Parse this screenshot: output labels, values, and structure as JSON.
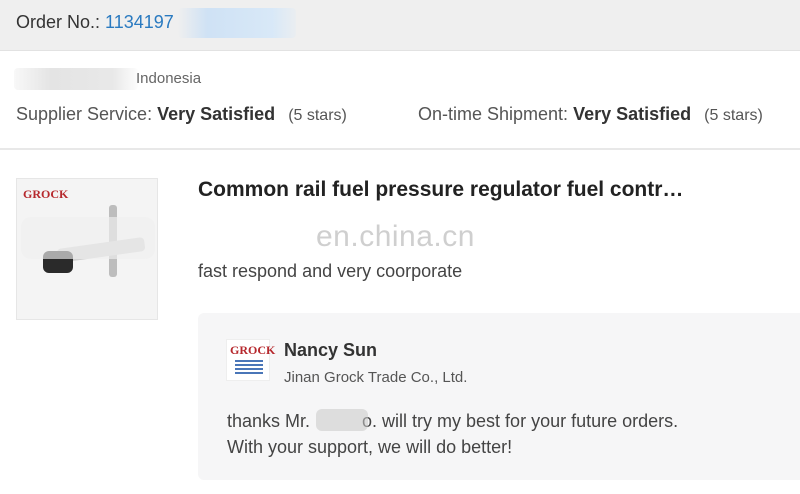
{
  "order": {
    "label": "Order No.:",
    "number_visible": "1134197"
  },
  "buyer": {
    "country": "Indonesia"
  },
  "ratings": [
    {
      "label": "Supplier Service:",
      "value": "Very Satisfied",
      "stars": "(5 stars)"
    },
    {
      "label": "On-time Shipment:",
      "value": "Very Satisfied",
      "stars": "(5 stars)"
    }
  ],
  "product": {
    "logo_text": "GROCK",
    "title": "Common rail fuel pressure regulator fuel contr…"
  },
  "watermark": "en.china.cn",
  "review": {
    "text": "fast respond and very coorporate"
  },
  "reply": {
    "logo_text": "GROCK",
    "name": "Nancy Sun",
    "company": "Jinan Grock Trade Co., Ltd.",
    "line1_prefix": "thanks Mr.",
    "line1_suffix": "o. will try my best for your future orders.",
    "line2": "With your support, we will do better!"
  },
  "colors": {
    "header_bg": "#efefef",
    "link": "#2a7ac0",
    "reply_bg": "#f6f6f7",
    "logo_red": "#b6282d"
  }
}
